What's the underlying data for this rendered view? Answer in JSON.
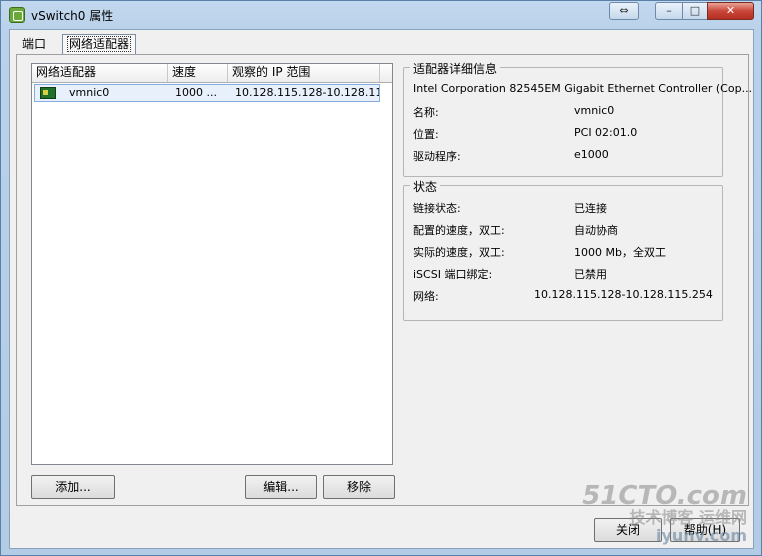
{
  "window": {
    "title": "vSwitch0 属性",
    "controls": {
      "alt_icon": "⇔",
      "minimize": "–",
      "maximize": "□",
      "close": "✕"
    }
  },
  "tabs": [
    {
      "label": "端口"
    },
    {
      "label": "网络适配器"
    }
  ],
  "adapter_list": {
    "columns": [
      "网络适配器",
      "速度",
      "观察的 IP 范围"
    ],
    "rows": [
      {
        "name": "vmnic0",
        "speed": "1000 ...",
        "ip": "10.128.115.128-10.128.115...",
        "icon": "nic-icon"
      }
    ]
  },
  "buttons": {
    "add": "添加...",
    "edit": "编辑...",
    "remove": "移除",
    "ok": "关闭",
    "help": "帮助(H)"
  },
  "adapter_details": {
    "legend": "适配器详细信息",
    "description": "Intel Corporation 82545EM Gigabit Ethernet Controller (Cop...",
    "name_label": "名称:",
    "name_value": "vmnic0",
    "location_label": "位置:",
    "location_value": "PCI 02:01.0",
    "driver_label": "驱动程序:",
    "driver_value": "e1000"
  },
  "status": {
    "legend": "状态",
    "link_label": "链接状态:",
    "link_value": "已连接",
    "configured_label": "配置的速度，双工:",
    "configured_value": "自动协商",
    "actual_label": "实际的速度，双工:",
    "actual_value": "1000 Mb，全双工",
    "iscsi_label": "iSCSI 端口绑定:",
    "iscsi_value": "已禁用",
    "network_label": "网络:",
    "network_value": "10.128.115.128-10.128.115.254"
  },
  "watermark": {
    "line1": "51CTO.com",
    "line2": "技术博客 运维网",
    "line3": "iyunv.com"
  }
}
